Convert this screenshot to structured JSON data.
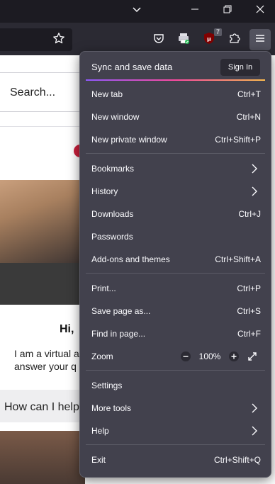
{
  "menu": {
    "sync": {
      "title": "Sync and save data",
      "signin_label": "Sign In"
    },
    "items": [
      {
        "label": "New tab",
        "shortcut": "Ctrl+T"
      },
      {
        "label": "New window",
        "shortcut": "Ctrl+N"
      },
      {
        "label": "New private window",
        "shortcut": "Ctrl+Shift+P"
      },
      {
        "label": "Bookmarks",
        "shortcut": ""
      },
      {
        "label": "History",
        "shortcut": ""
      },
      {
        "label": "Downloads",
        "shortcut": "Ctrl+J"
      },
      {
        "label": "Passwords",
        "shortcut": ""
      },
      {
        "label": "Add-ons and themes",
        "shortcut": "Ctrl+Shift+A"
      },
      {
        "label": "Print...",
        "shortcut": "Ctrl+P"
      },
      {
        "label": "Save page as...",
        "shortcut": "Ctrl+S"
      },
      {
        "label": "Find in page...",
        "shortcut": "Ctrl+F"
      },
      {
        "label": "Zoom",
        "shortcut": ""
      },
      {
        "label": "Settings",
        "shortcut": ""
      },
      {
        "label": "More tools",
        "shortcut": ""
      },
      {
        "label": "Help",
        "shortcut": ""
      },
      {
        "label": "Exit",
        "shortcut": "Ctrl+Shift+Q"
      }
    ],
    "zoom_value": "100%"
  },
  "toolbar": {
    "extension_badge": "7"
  },
  "page": {
    "search_label": "Search...",
    "chat_greeting": "Hi,",
    "chat_message_line1": "I am a virtual a",
    "chat_message_line2": "answer your q",
    "chat_input_text": "How can I help"
  },
  "colors": {
    "menu_bg": "#42414d",
    "toolbar_bg": "#2b2a33",
    "titlebar_bg": "#1c1b22",
    "accent_gradient_start": "#9059ff",
    "accent_gradient_end": "#ffbd4f"
  }
}
